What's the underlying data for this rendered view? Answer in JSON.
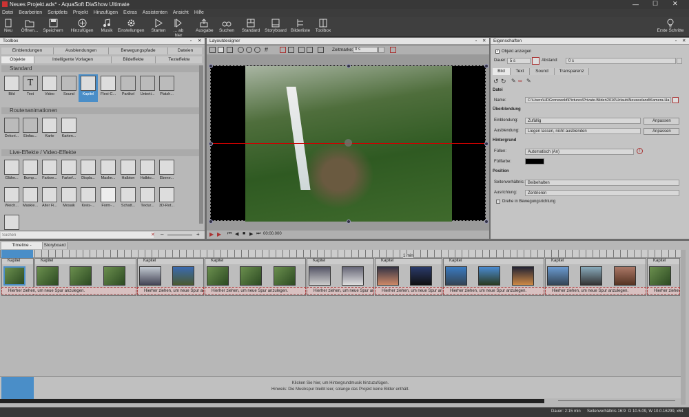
{
  "window": {
    "title": "Neues Projekt.ads* - AquaSoft DiaShow Ultimate"
  },
  "menu": [
    "Datei",
    "Bearbeiten",
    "Scriptlets",
    "Projekt",
    "Hinzufügen",
    "Extras",
    "Assistenten",
    "Ansicht",
    "Hilfe"
  ],
  "ribbon": {
    "neu": "Neu",
    "oeffnen": "Öffnen...",
    "speichern": "Speichern",
    "hinzufuegen": "Hinzufügen",
    "musik": "Musik",
    "einstellungen": "Einstellungen",
    "starten": "Starten",
    "abhier": "... ab hier",
    "ausgabe": "Ausgabe",
    "suchen": "Suchen",
    "standard": "Standard",
    "storyboard": "Storyboard",
    "bilderliste": "Bilderliste",
    "toolbox": "Toolbox",
    "erste": "Erste Schritte"
  },
  "toolbox": {
    "title": "Toolbox",
    "tabs_top": [
      "Einblendungen",
      "Ausblendungen",
      "Bewegungspfade",
      "Dateien"
    ],
    "tabs_bottom": [
      "Objekte",
      "Intelligente Vorlagen",
      "Bildeffekte",
      "Texteffekte"
    ],
    "sections": {
      "standard": "Standard",
      "routen": "Routenanimationen",
      "live": "Live-Effekte / Video-Effekte"
    },
    "standard_items": [
      "Bild",
      "Text",
      "Video",
      "Sound",
      "Kapitel",
      "Flexi-C...",
      "Partikel",
      "Unterti...",
      "Platzh..."
    ],
    "routen_items": [
      "Dekori...",
      "Einfac...",
      "Karte",
      "Karten..."
    ],
    "live_row1": [
      "Glühe...",
      "Bump...",
      "Farbve...",
      "Farbef...",
      "Displa...",
      "Maske...",
      "Halbton",
      "Halbto...",
      "Ebene..."
    ],
    "live_row2": [
      "Weich...",
      "Maskie...",
      "Alter Fi...",
      "Mosaik",
      "Kreis-...",
      "Form-...",
      "Schatt...",
      "Textur...",
      "3D-Rot..."
    ],
    "search_placeholder": "Suchen"
  },
  "layout": {
    "title": "Layoutdesigner",
    "zeitmarke_label": "Zeitmarke:",
    "zeitmarke_value": "0 s",
    "time": "00:00.000"
  },
  "props": {
    "title": "Eigenschaften",
    "show_object": "Objekt anzeigen",
    "dauer_label": "Dauer:",
    "dauer_value": "5 s",
    "abstand_label": "Abstand:",
    "abstand_value": "0 s",
    "tabs": [
      "Bild",
      "Text",
      "Sound",
      "Transparenz"
    ],
    "datei_section": "Datei",
    "name_label": "Name:",
    "name_value": "C:\\Users\\HDGronewold\\Pictures\\Private-Bilder\\2016\\Urlaub\\Neuseeland\\Kamera-Ha",
    "ueberblendung_section": "Überblendung",
    "einblendung_label": "Einblendung:",
    "einblendung_value": "Zufällig",
    "ausblendung_label": "Ausblendung:",
    "ausblendung_value": "Liegen lassen, nicht ausblenden",
    "anpassen": "Anpassen",
    "hintergrund_section": "Hintergrund",
    "fuellen_label": "Füllen:",
    "fuellen_value": "Automatisch (An)",
    "fuellfarbe_label": "Füllfarbe:",
    "position_section": "Position",
    "seiten_label": "Seitenverhältnis:",
    "seiten_value": "Beibehalten",
    "ausrichtung_label": "Ausrichtung:",
    "ausrichtung_value": "Zentrieren",
    "drehe_label": "Drehe in Bewegungsrichtung"
  },
  "timeline": {
    "tabs": [
      "Timeline - Spuransicht",
      "Storyboard"
    ],
    "ruler_label": "1 min",
    "chapter_label": "Kapitel",
    "dropzone": "Hierher ziehen, um neue Spur anzulegen.",
    "music_line1": "Klicken Sie hier, um Hintergrundmusik hinzuzufügen.",
    "music_line2": "Hinweis: Die Musikspur bleibt leer, solange das Projekt keine Bilder enthält."
  },
  "status": {
    "dauer": "Dauer: 2:15 min",
    "seiten": "Seitenverhältnis 16:9",
    "version": "D 10.5.09, W 10.0.16299, x64"
  },
  "colors": {
    "accent": "#4a8ec8",
    "dark": "#3c3c3c"
  }
}
